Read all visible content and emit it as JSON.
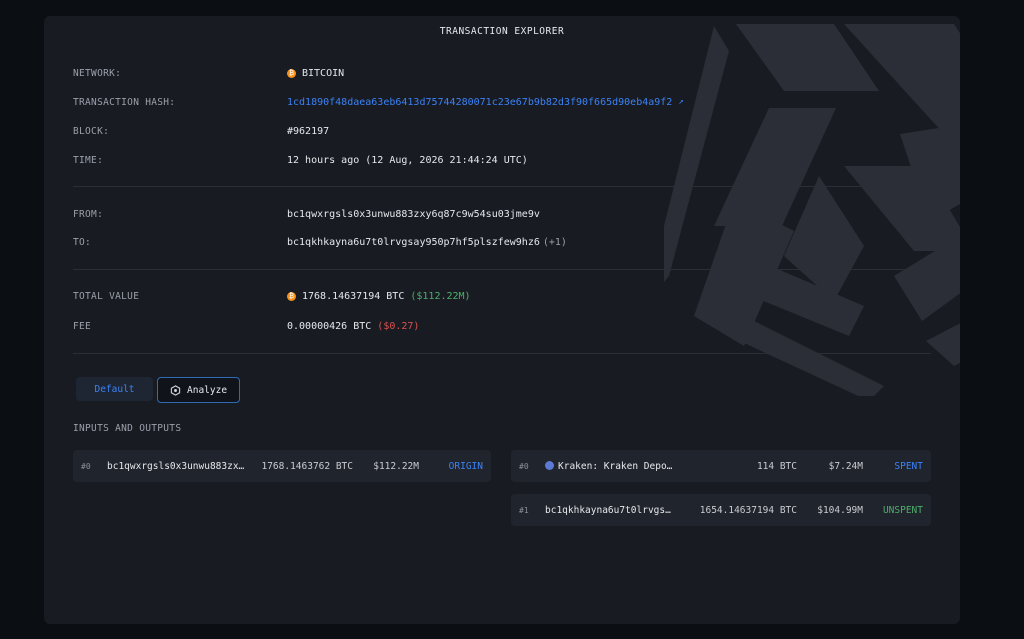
{
  "header": {
    "title": "TRANSACTION EXPLORER"
  },
  "details": {
    "network_label": "NETWORK:",
    "network_value": "BITCOIN",
    "hash_label": "TRANSACTION HASH:",
    "hash_value": "1cd1890f48daea63eb6413d75744280071c23e67b9b82d3f90f665d90eb4a9f2",
    "block_label": "BLOCK:",
    "block_value": "#962197",
    "time_label": "TIME:",
    "time_value": "12 hours ago",
    "time_exact": "(12 Aug, 2026 21:44:24 UTC)",
    "from_label": "FROM:",
    "from_value": "bc1qwxrgsls0x3unwu883zxy6q87c9w54su03jme9v",
    "to_label": "TO:",
    "to_value": "bc1qkhkayna6u7t0lrvgsay950p7hf5plszfew9hz6",
    "to_extra": "(+1)",
    "total_label": "TOTAL VALUE",
    "total_btc": "1768.14637194 BTC",
    "total_usd": "($112.22M)",
    "fee_label": "FEE",
    "fee_btc": "0.00000426 BTC",
    "fee_usd": "($0.27)"
  },
  "tabs": {
    "default": "Default",
    "analyze": "Analyze"
  },
  "io": {
    "title": "INPUTS AND OUTPUTS",
    "inputs": [
      {
        "index": "#0",
        "address": "bc1qwxrgsls0x3unwu883zx…",
        "amount": "1768.1463762 BTC",
        "usd": "$112.22M",
        "status": "ORIGIN"
      }
    ],
    "outputs": [
      {
        "index": "#0",
        "address": "Kraken: Kraken Depo…",
        "amount": "114 BTC",
        "usd": "$7.24M",
        "status": "SPENT"
      },
      {
        "index": "#1",
        "address": "bc1qkhkayna6u7t0lrvgs…",
        "amount": "1654.14637194 BTC",
        "usd": "$104.99M",
        "status": "UNSPENT"
      }
    ]
  },
  "colors": {
    "accent": "#3b82f6",
    "btc": "#f7931a",
    "positive": "#4caf6a",
    "negative": "#d9534f"
  },
  "icons": {
    "btc": "bitcoin-coin-icon",
    "external": "external-link-icon",
    "analyze": "analyze-icon",
    "kraken": "kraken-logo-icon"
  }
}
